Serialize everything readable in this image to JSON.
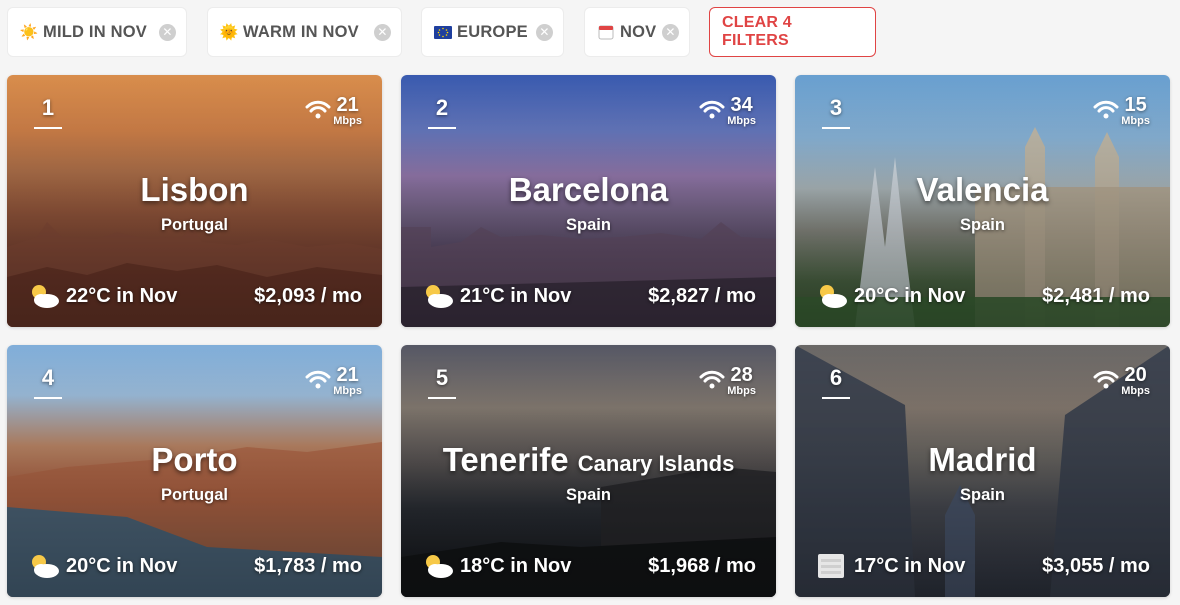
{
  "filters": [
    {
      "emoji": "☀️",
      "label": "MILD IN NOV"
    },
    {
      "emoji": "🌞",
      "label": "WARM IN NOV"
    },
    {
      "emoji": "🇪🇺",
      "label": "EUROPE"
    },
    {
      "emoji": "🗓️",
      "label": "NOV"
    }
  ],
  "clear_label": "CLEAR 4 FILTERS",
  "wifi_unit": "Mbps",
  "cities": [
    {
      "rank": "1",
      "name": "Lisbon",
      "sub": "",
      "country": "Portugal",
      "wifi": "21",
      "temp": "22°C in Nov",
      "cost": "$2,093 / mo",
      "weather_icon": "partly-cloudy"
    },
    {
      "rank": "2",
      "name": "Barcelona",
      "sub": "",
      "country": "Spain",
      "wifi": "34",
      "temp": "21°C in Nov",
      "cost": "$2,827 / mo",
      "weather_icon": "partly-cloudy"
    },
    {
      "rank": "3",
      "name": "Valencia",
      "sub": "",
      "country": "Spain",
      "wifi": "15",
      "temp": "20°C in Nov",
      "cost": "$2,481 / mo",
      "weather_icon": "partly-cloudy"
    },
    {
      "rank": "4",
      "name": "Porto",
      "sub": "",
      "country": "Portugal",
      "wifi": "21",
      "temp": "20°C in Nov",
      "cost": "$1,783 / mo",
      "weather_icon": "partly-cloudy"
    },
    {
      "rank": "5",
      "name": "Tenerife",
      "sub": "Canary Islands",
      "country": "Spain",
      "wifi": "28",
      "temp": "18°C in Nov",
      "cost": "$1,968 / mo",
      "weather_icon": "partly-cloudy"
    },
    {
      "rank": "6",
      "name": "Madrid",
      "sub": "",
      "country": "Spain",
      "wifi": "20",
      "temp": "17°C in Nov",
      "cost": "$3,055 / mo",
      "weather_icon": "fog"
    }
  ]
}
